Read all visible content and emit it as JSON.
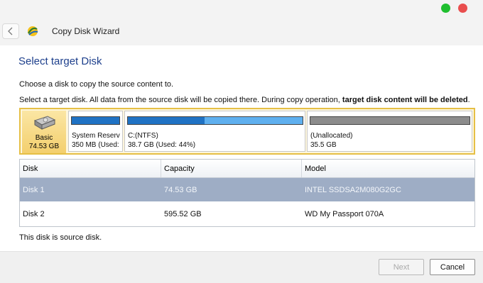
{
  "window": {
    "title": "Copy Disk Wizard",
    "controls": [
      "green-dot",
      "red-dot"
    ]
  },
  "page": {
    "heading": "Select target Disk",
    "instruction1": "Choose a disk to copy the source content to.",
    "instruction2_plain": "Select a target disk. All data from the source disk will be copied there. During copy operation,",
    "instruction2_bold": "target disk content will be deleted",
    "instruction2_end": "."
  },
  "disk_map": {
    "disk": {
      "type_label": "Basic",
      "size_label": "74.53 GB"
    },
    "partitions": [
      {
        "name": "System Reserv",
        "detail": "350 MB (Used:",
        "used_fraction": 1.0,
        "bar_color": "#1f72c4"
      },
      {
        "name": "C:(NTFS)",
        "detail": "38.7 GB (Used: 44%)",
        "used_fraction": 0.44,
        "bar_color": "#1f72c4"
      },
      {
        "name": "(Unallocated)",
        "detail": "35.5 GB",
        "used_fraction": 1.0,
        "bar_color": "#8c8c8c"
      }
    ]
  },
  "table": {
    "columns": [
      "Disk",
      "Capacity",
      "Model"
    ],
    "rows": [
      {
        "disk": "Disk 1",
        "capacity": "74.53 GB",
        "model": "INTEL SSDSA2M080G2GC",
        "selected": true
      },
      {
        "disk": "Disk 2",
        "capacity": "595.52 GB",
        "model": "WD My Passport 070A",
        "selected": false
      }
    ]
  },
  "status": "This disk is source disk.",
  "buttons": {
    "next": "Next",
    "cancel": "Cancel"
  },
  "colors": {
    "accent": "#1d3f8c",
    "selection": "#9eadc5",
    "disk_map_border": "#e6bf45"
  }
}
